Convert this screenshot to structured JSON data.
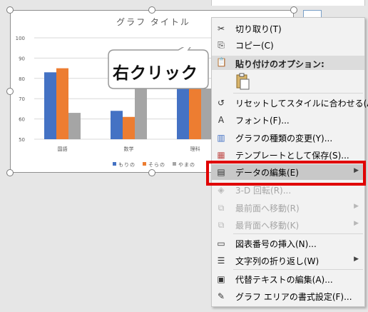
{
  "chart_data": {
    "type": "bar",
    "title": "グラフ タイトル",
    "categories": [
      "国語",
      "数学",
      "理科"
    ],
    "series": [
      {
        "name": "もりの",
        "color": "#4472c4",
        "values": [
          83,
          64,
          94
        ]
      },
      {
        "name": "そらの",
        "color": "#ed7d31",
        "values": [
          85,
          61,
          88
        ]
      },
      {
        "name": "やまの",
        "color": "#a5a5a5",
        "values": [
          63,
          90,
          75
        ]
      }
    ],
    "yticks": [
      "100",
      "90",
      "80",
      "70",
      "60",
      "50"
    ],
    "ylim": [
      50,
      100
    ],
    "grid": true,
    "legend": "bottom"
  },
  "callout": {
    "text": "右クリック"
  },
  "context_menu": {
    "items": [
      {
        "id": "cut",
        "icon": "scissors-icon",
        "glyph": "✂",
        "label": "切り取り(T)"
      },
      {
        "id": "copy",
        "icon": "copy-icon",
        "glyph": "⎘",
        "label": "コピー(C)"
      },
      {
        "id": "paste-options-header",
        "label": "貼り付けのオプション:"
      },
      {
        "id": "reset-style",
        "icon": "reset-style-icon",
        "glyph": "↺",
        "label": "リセットしてスタイルに合わせる(A)"
      },
      {
        "id": "font",
        "icon": "font-icon",
        "glyph": "A",
        "label": "フォント(F)..."
      },
      {
        "id": "change-chart-type",
        "icon": "chart-type-icon",
        "glyph": "▥",
        "label": "グラフの種類の変更(Y)..."
      },
      {
        "id": "save-template",
        "icon": "template-icon",
        "glyph": "▦",
        "label": "テンプレートとして保存(S)..."
      },
      {
        "id": "edit-data",
        "icon": "edit-data-icon",
        "glyph": "▤",
        "label": "データの編集(E)"
      },
      {
        "id": "rotate-3d",
        "icon": "rotate-3d-icon",
        "glyph": "◈",
        "label": "3-D 回転(R)..."
      },
      {
        "id": "bring-front",
        "icon": "bring-front-icon",
        "glyph": "⧉",
        "label": "最前面へ移動(R)"
      },
      {
        "id": "send-back",
        "icon": "send-back-icon",
        "glyph": "⧉",
        "label": "最背面へ移動(K)"
      },
      {
        "id": "insert-caption",
        "icon": "caption-icon",
        "glyph": "▭",
        "label": "図表番号の挿入(N)..."
      },
      {
        "id": "wrap-text",
        "icon": "wrap-text-icon",
        "glyph": "☰",
        "label": "文字列の折り返し(W)"
      },
      {
        "id": "alt-text",
        "icon": "alt-text-icon",
        "glyph": "▣",
        "label": "代替テキストの編集(A)..."
      },
      {
        "id": "format-chart-area",
        "icon": "format-icon",
        "glyph": "✎",
        "label": "グラフ エリアの書式設定(F)..."
      }
    ]
  }
}
